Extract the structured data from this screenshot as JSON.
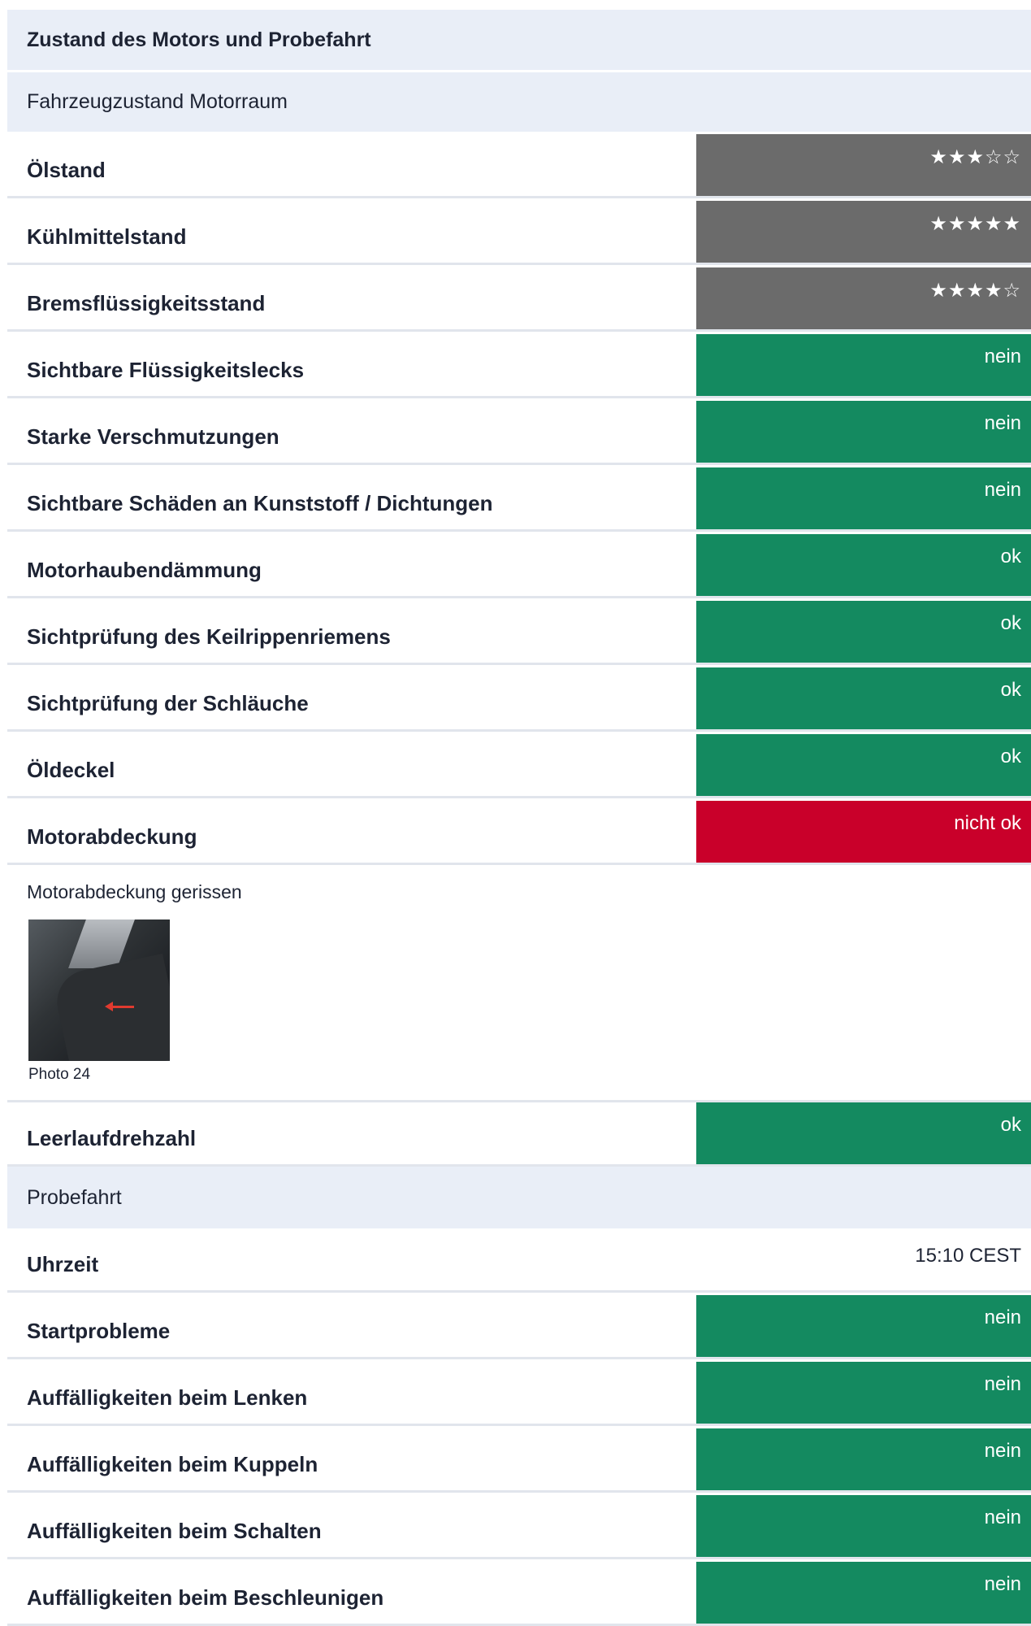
{
  "section": {
    "title": "Zustand des Motors und Probefahrt"
  },
  "engine_bay": {
    "title": "Fahrzeugzustand Motorraum",
    "rows": [
      {
        "label": "Ölstand",
        "value": "★★★☆☆",
        "rating": 3,
        "status": "grey"
      },
      {
        "label": "Kühlmittelstand",
        "value": "★★★★★",
        "rating": 5,
        "status": "grey"
      },
      {
        "label": "Bremsflüssigkeitsstand",
        "value": "★★★★☆",
        "rating": 4,
        "status": "grey"
      },
      {
        "label": "Sichtbare Flüssigkeitslecks",
        "value": "nein",
        "status": "green"
      },
      {
        "label": "Starke Verschmutzungen",
        "value": "nein",
        "status": "green"
      },
      {
        "label": "Sichtbare Schäden an Kunststoff / Dichtungen",
        "value": "nein",
        "status": "green"
      },
      {
        "label": "Motorhaubendämmung",
        "value": "ok",
        "status": "green"
      },
      {
        "label": "Sichtprüfung des Keilrippenriemens",
        "value": "ok",
        "status": "green"
      },
      {
        "label": "Sichtprüfung der Schläuche",
        "value": "ok",
        "status": "green"
      },
      {
        "label": "Öldeckel",
        "value": "ok",
        "status": "green"
      },
      {
        "label": "Motorabdeckung",
        "value": "nicht ok",
        "status": "red"
      }
    ],
    "note": {
      "comment": "Motorabdeckung gerissen",
      "photo_caption": "Photo 24"
    },
    "idle_row": {
      "label": "Leerlaufdrehzahl",
      "value": "ok",
      "status": "green"
    }
  },
  "test_drive": {
    "title": "Probefahrt",
    "time_row": {
      "label": "Uhrzeit",
      "value": "15:10 CEST"
    },
    "rows": [
      {
        "label": "Startprobleme",
        "value": "nein",
        "status": "green"
      },
      {
        "label": "Auffälligkeiten beim Lenken",
        "value": "nein",
        "status": "green"
      },
      {
        "label": "Auffälligkeiten beim Kuppeln",
        "value": "nein",
        "status": "green"
      },
      {
        "label": "Auffälligkeiten beim Schalten",
        "value": "nein",
        "status": "green"
      },
      {
        "label": "Auffälligkeiten beim Beschleunigen",
        "value": "nein",
        "status": "green"
      }
    ]
  },
  "colors": {
    "header_bg": "#e9eef7",
    "grey": "#6b6b6b",
    "green": "#148a60",
    "red": "#c9002a",
    "text": "#1d2333"
  }
}
